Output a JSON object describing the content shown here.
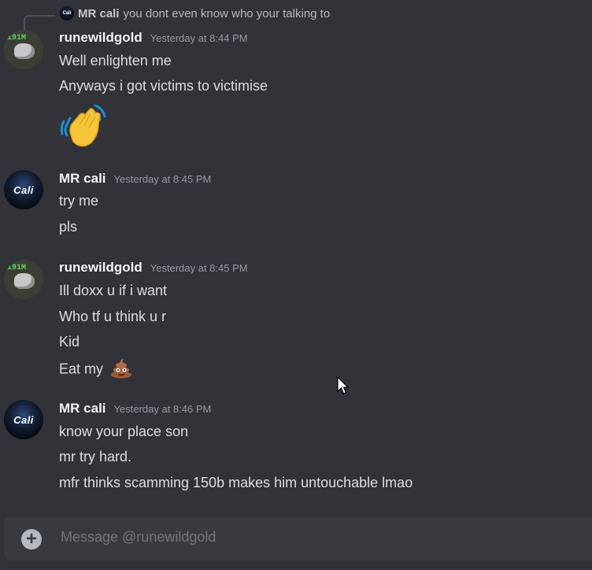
{
  "reply": {
    "author": "MR cali",
    "text": "you dont even know who your talking to",
    "avatar_text": "Cali"
  },
  "messages": [
    {
      "author": "runewildgold",
      "timestamp": "Yesterday at 8:44 PM",
      "avatar": "rune",
      "avatar_text": "191M",
      "lines": [
        "Well enlighten me",
        "Anyways i got victims to victimise"
      ],
      "big_emoji": "waving-hand"
    },
    {
      "author": "MR cali",
      "timestamp": "Yesterday at 8:45 PM",
      "avatar": "cali",
      "avatar_text": "Cali",
      "lines": [
        "try me",
        "pls"
      ]
    },
    {
      "author": "runewildgold",
      "timestamp": "Yesterday at 8:45 PM",
      "avatar": "rune",
      "avatar_text": "191M",
      "lines": [
        "Ill doxx u if i want",
        "Who tf u think u r",
        "Kid",
        "Eat my"
      ],
      "inline_emoji": "pile-of-poo"
    },
    {
      "author": "MR cali",
      "timestamp": "Yesterday at 8:46 PM",
      "avatar": "cali",
      "avatar_text": "Cali",
      "lines": [
        "know your place son",
        "mr try hard.",
        "mfr thinks scamming 150b makes him untouchable lmao"
      ]
    }
  ],
  "composer": {
    "placeholder": "Message @runewildgold",
    "add_icon": "plus-circle-icon"
  },
  "colors": {
    "background": "#313338",
    "composer": "#383a40",
    "text": "#dbdee1",
    "muted": "#949ba4"
  }
}
